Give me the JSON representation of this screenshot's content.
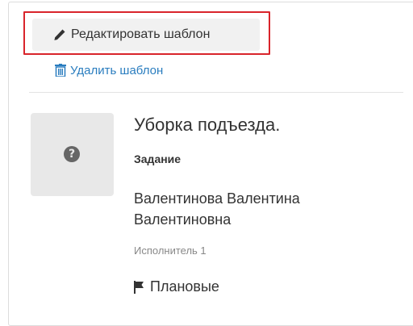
{
  "toolbar": {
    "edit_label": "Редактировать шаблон",
    "delete_label": "Удалить шаблон"
  },
  "task": {
    "title": "Уборка подъезда.",
    "type": "Задание",
    "assignee_line1": "Валентинова Валентина",
    "assignee_line2": "Валентиновна",
    "role": "Исполнитель 1",
    "priority": "Плановые",
    "avatar_glyph": "?"
  },
  "icons": {
    "edit": "pencil-icon",
    "delete": "trash-icon",
    "avatar": "question-circle-icon",
    "priority": "flag-icon"
  },
  "colors": {
    "highlight": "#d9242b",
    "link": "#2a7dbf",
    "button_bg": "#f1f1f1",
    "avatar_bg": "#e8e8e8"
  }
}
